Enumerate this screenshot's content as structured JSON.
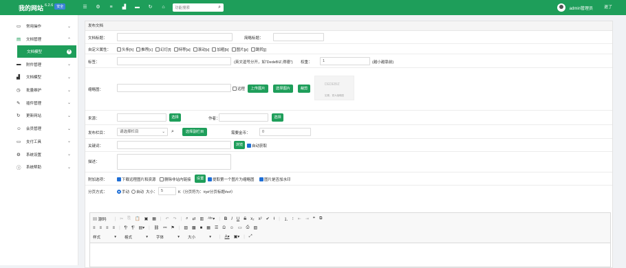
{
  "topbar": {
    "site_name": "我的网站",
    "version": "6.2.6",
    "badge": "安全",
    "search_placeholder": "功能搜索",
    "username": "admin管理员",
    "logout": "退了",
    "icons": [
      "menu-icon",
      "gear-icon",
      "list-icon",
      "chart-icon",
      "folder-icon",
      "refresh-icon",
      "home-icon"
    ]
  },
  "sidebar": {
    "items": [
      {
        "label": "常用操作",
        "icon": "monitor-icon"
      },
      {
        "label": "文档管理",
        "icon": "document-icon"
      },
      {
        "label": "附件管理",
        "icon": "folder-icon"
      },
      {
        "label": "文档模型",
        "icon": "chart-icon"
      },
      {
        "label": "批量维护",
        "icon": "clock-icon"
      },
      {
        "label": "插件管理",
        "icon": "plug-icon"
      },
      {
        "label": "更新网站",
        "icon": "refresh-icon"
      },
      {
        "label": "会员管理",
        "icon": "user-icon"
      },
      {
        "label": "支付工具",
        "icon": "card-icon"
      },
      {
        "label": "系统设置",
        "icon": "gear-icon"
      },
      {
        "label": "系统帮助",
        "icon": "info-icon"
      }
    ],
    "active_sub": "文档模型"
  },
  "form": {
    "header": "发布文档",
    "title_label": "文档标题：",
    "short_title_label": "简略标题：",
    "attr_label": "自定义属性：",
    "attrs": [
      "头条[h]",
      "推荐[c]",
      "幻灯[f]",
      "特荐[a]",
      "滚动[s]",
      "加粗[b]",
      "图片[p]",
      "跳转[j]"
    ],
    "tags_label": "标签：",
    "tags_hint": "(英文逗号分开，如“DedeBIZ,得德”)",
    "weight_label": "权重：",
    "weight_value": "1",
    "weight_hint": "(越小越靠前)",
    "thumb_label": "缩略图：",
    "remote_label": "远程",
    "upload_btn": "上传图片",
    "choose_btn": "选择图片",
    "crop_btn": "裁剪",
    "thumb_logo": "DEDEBIZ",
    "thumb_caption": "如果，更大缩略图",
    "source_label": "来源：",
    "select_btn": "选择",
    "author_label": "作者：",
    "column_label": "发布栏目：",
    "column_value": "请选择栏目",
    "sub_column_btn": "选择副栏目",
    "gold_label": "需要金币：",
    "gold_value": "0",
    "keywords_label": "关键词：",
    "browse_btn": "浏览",
    "auto_get": "自动获取",
    "desc_label": "描述：",
    "extra_label": "附加选项：",
    "opt1": "下载远程图片和资源",
    "opt2": "删除非站内链接",
    "settings_btn": "设置",
    "opt3": "提取第一个图片为缩略图",
    "opt4": "图片是否加水印",
    "paging_label": "分页方式：",
    "manual": "手动",
    "auto": "自动",
    "size_label": "大小：",
    "size_value": "5",
    "size_hint": "K（分页符为：#p#分页标题#e#）"
  },
  "editor": {
    "source": "源码",
    "style": "样式",
    "format": "格式",
    "font": "字体",
    "size": "大小"
  }
}
